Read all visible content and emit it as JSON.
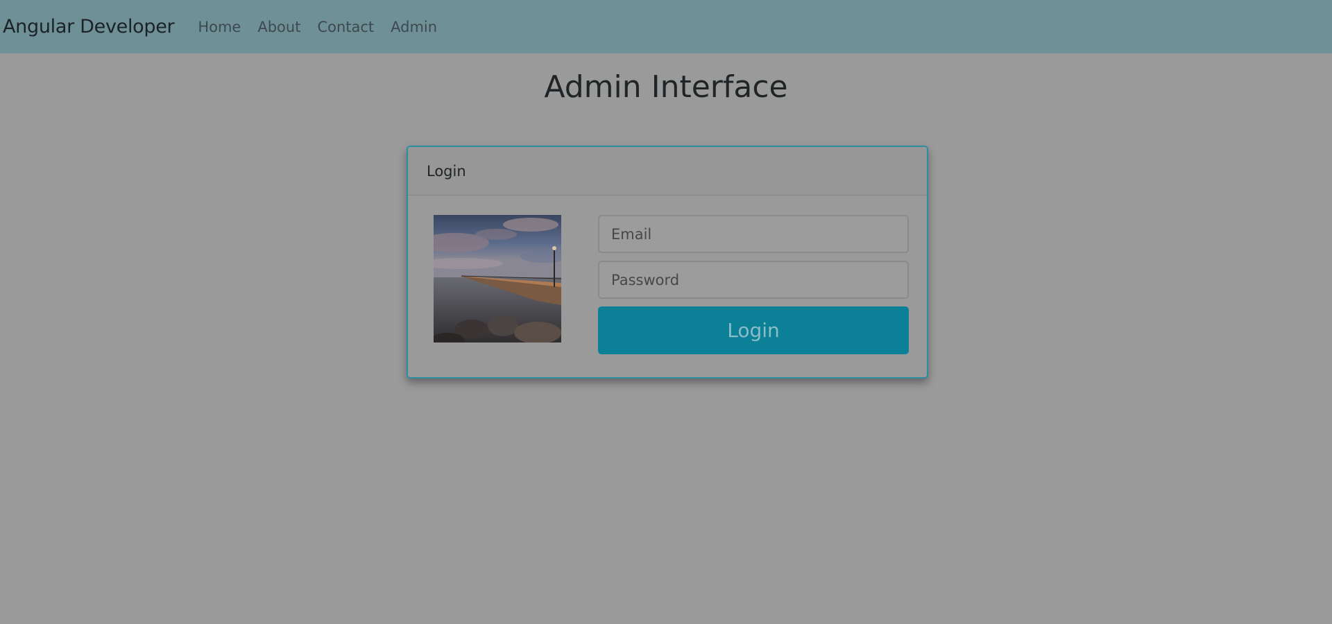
{
  "navbar": {
    "brand": "Angular Developer",
    "links": [
      {
        "label": "Home"
      },
      {
        "label": "About"
      },
      {
        "label": "Contact"
      },
      {
        "label": "Admin"
      }
    ],
    "background": "#6e9096"
  },
  "page": {
    "title": "Admin Interface",
    "background": "#9a9a9a"
  },
  "login_card": {
    "header": "Login",
    "border_color": "#2a8ea0",
    "image": "pier-at-dusk-photo",
    "email": {
      "placeholder": "Email",
      "value": ""
    },
    "password": {
      "placeholder": "Password",
      "value": ""
    },
    "submit_label": "Login",
    "submit_color": "#0c8096"
  }
}
